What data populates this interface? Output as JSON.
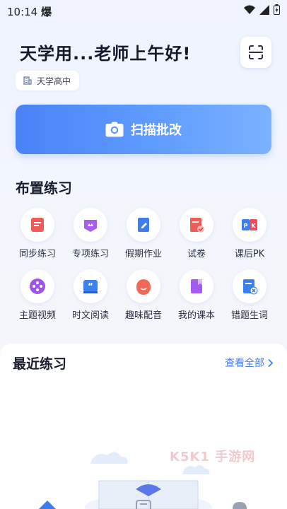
{
  "status": {
    "time": "10:14",
    "extra": "爆"
  },
  "header": {
    "greeting": "天学用...老师上午好!",
    "school": "天学高中"
  },
  "banner": {
    "label": "扫描批改"
  },
  "practice": {
    "title": "布置练习",
    "items": [
      {
        "label": "同步练习",
        "icon": "book-icon",
        "color": "#f25a5a"
      },
      {
        "label": "专项练习",
        "icon": "crown-icon",
        "color": "#a85cf0"
      },
      {
        "label": "假期作业",
        "icon": "edit-doc-icon",
        "color": "#3f7cf0"
      },
      {
        "label": "试卷",
        "icon": "exam-check-icon",
        "color": "#f45a55"
      },
      {
        "label": "课后PK",
        "icon": "pk-icon",
        "color": "#ee4a5a"
      },
      {
        "label": "主题视频",
        "icon": "video-icon",
        "color": "#9d55e8"
      },
      {
        "label": "时文阅读",
        "icon": "quote-book-icon",
        "color": "#3b7ff0"
      },
      {
        "label": "趣味配音",
        "icon": "voice-icon",
        "color": "#f26a55"
      },
      {
        "label": "我的课本",
        "icon": "textbook-icon",
        "color": "#a45cf0"
      },
      {
        "label": "错题生词",
        "icon": "wrong-words-icon",
        "color": "#3b7ff0"
      }
    ]
  },
  "recent": {
    "title": "最近练习",
    "view_all": "查看全部"
  },
  "watermark": "K5K1 手游网"
}
